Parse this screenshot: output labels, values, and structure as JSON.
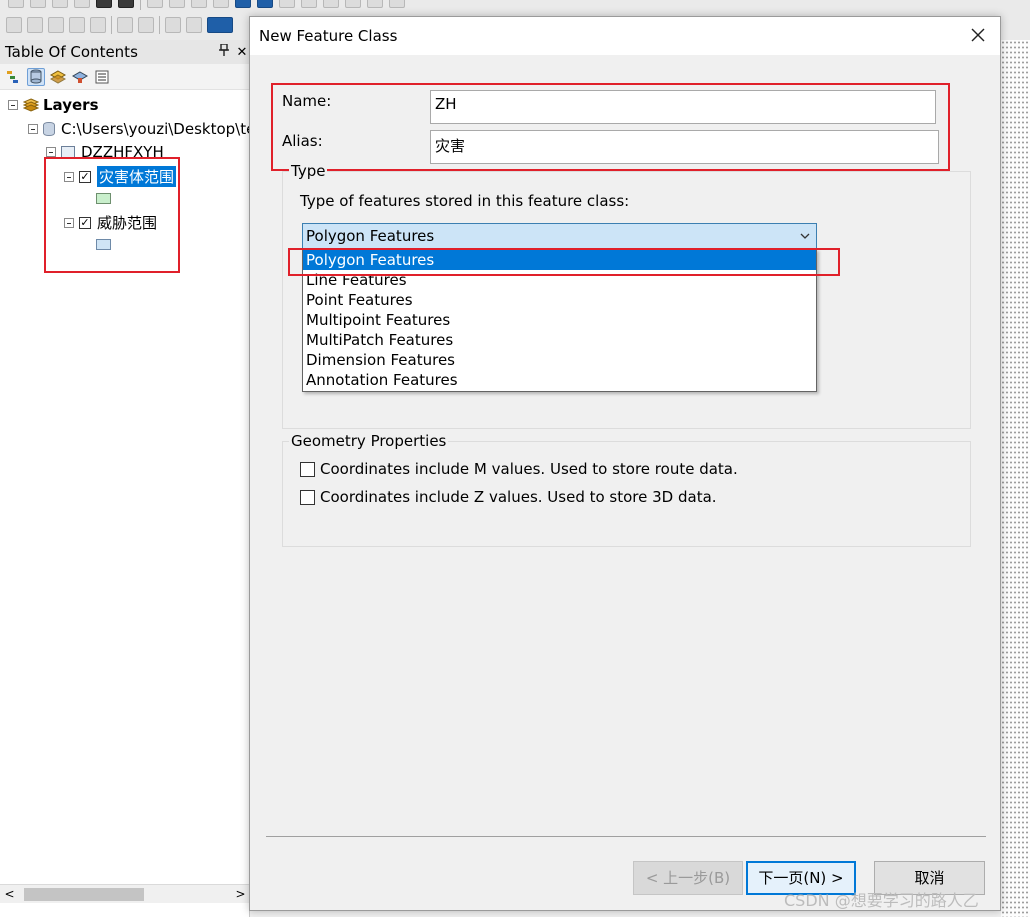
{
  "toc": {
    "title": "Table Of Contents",
    "pin_icon": "pin-icon",
    "close_glyph": "✕",
    "tree": {
      "root_label": "Layers",
      "db_path": "C:\\Users\\youzi\\Desktop\\te",
      "dataset": "DZZHFXYH",
      "layers": [
        {
          "label": "灾害体范围",
          "checked": true,
          "selected": true,
          "swatch": "#c9efcc"
        },
        {
          "label": "威胁范围",
          "checked": true,
          "selected": false,
          "swatch": "#cfe4f5"
        }
      ]
    }
  },
  "dialog": {
    "title": "New Feature Class",
    "name_label": "Name:",
    "name_value": "ZH",
    "alias_label": "Alias:",
    "alias_value": "灾害",
    "type_group_label": "Type",
    "type_prompt": "Type of features stored in this feature class:",
    "type_selected": "Polygon Features",
    "type_options": [
      "Polygon Features",
      "Line Features",
      "Point Features",
      "Multipoint Features",
      "MultiPatch Features",
      "Dimension Features",
      "Annotation Features"
    ],
    "geometry_group_label": "Geometry Properties",
    "m_values_label": "Coordinates include M values. Used to store route data.",
    "z_values_label": "Coordinates include Z values. Used to store 3D data.",
    "back_button": "< 上一步(B)",
    "next_button": "下一页(N) >",
    "cancel_button": "取消"
  },
  "watermark": "CSDN @想要学习的路人乙",
  "colors": {
    "highlight_red": "#e0202a",
    "selection_blue": "#0078d7"
  }
}
